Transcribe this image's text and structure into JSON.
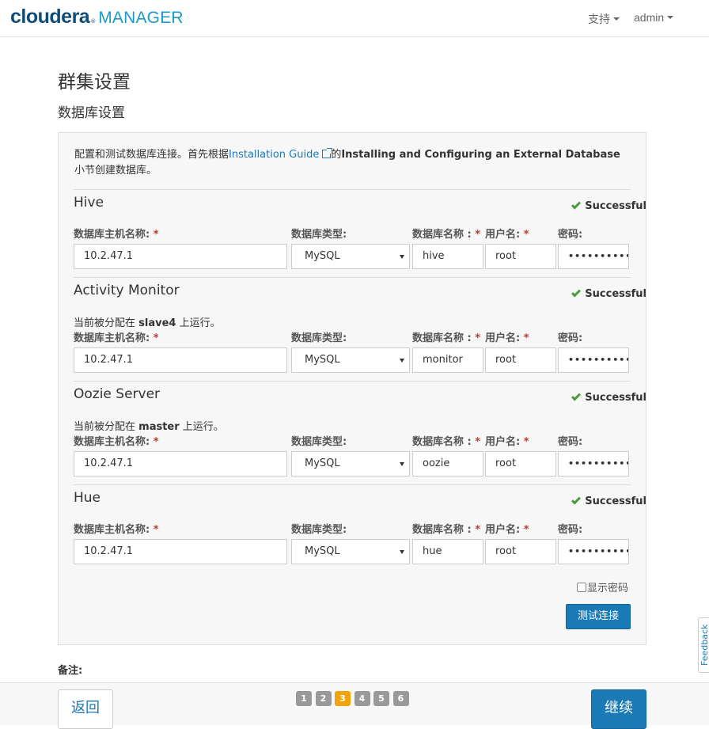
{
  "header": {
    "logo_primary": "cloudera",
    "logo_secondary": "MANAGER",
    "support_label": "支持",
    "user_label": "admin"
  },
  "page": {
    "title": "群集设置",
    "subtitle": "数据库设置"
  },
  "intro": {
    "prefix": "配置和测试数据库连接。首先根据",
    "link": "Installation Guide",
    "middle": "的",
    "bold": "Installing and Configuring an External Database",
    "suffix": "小节创建数据库。"
  },
  "labels": {
    "host": "数据库主机名称:",
    "type": "数据库类型:",
    "dbname": "数据库名称 :",
    "user": "用户名:",
    "password": "密码:",
    "required": "*",
    "assigned_prefix": "当前被分配在",
    "assigned_suffix": "上运行。"
  },
  "services": [
    {
      "name": "Hive",
      "status": "Successful",
      "host": "10.2.47.1",
      "type": "MySQL",
      "dbname": "hive",
      "user": "root",
      "password": "••••••••••",
      "assigned_host": ""
    },
    {
      "name": "Activity Monitor",
      "status": "Successful",
      "host": "10.2.47.1",
      "type": "MySQL",
      "dbname": "monitor",
      "user": "root",
      "password": "••••••••••",
      "assigned_host": "slave4"
    },
    {
      "name": "Oozie Server",
      "status": "Successful",
      "host": "10.2.47.1",
      "type": "MySQL",
      "dbname": "oozie",
      "user": "root",
      "password": "••••••••••",
      "assigned_host": "master"
    },
    {
      "name": "Hue",
      "status": "Successful",
      "host": "10.2.47.1",
      "type": "MySQL",
      "dbname": "hue",
      "user": "root",
      "password": "••••••••••",
      "assigned_host": ""
    }
  ],
  "show_password_label": "显示密码",
  "test_connection_label": "测试连接",
  "notes_label": "备注:",
  "footer": {
    "back_label": "返回",
    "next_label": "继续",
    "steps": [
      "1",
      "2",
      "3",
      "4",
      "5",
      "6"
    ],
    "active_step": "3"
  },
  "feedback_label": "Feedback",
  "colors": {
    "primary": "#1a7ab6",
    "success": "#4a9d3b",
    "active_step": "#f0a30a"
  }
}
